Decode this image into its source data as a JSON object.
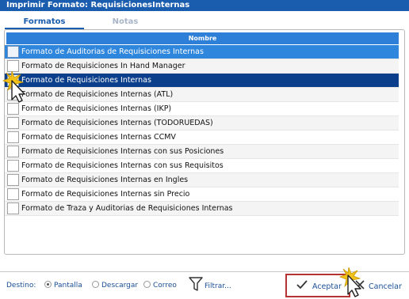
{
  "window": {
    "title": "Imprimir Formato: RequisicionesInternas"
  },
  "tabs": [
    {
      "label": "Formatos",
      "active": true
    },
    {
      "label": "Notas",
      "active": false
    }
  ],
  "grid": {
    "column_header": "Nombre",
    "rows": [
      {
        "label": "Formato de Auditorias de Requisiciones Internas",
        "state": "hover"
      },
      {
        "label": "Formato de Requisiciones In Hand Manager",
        "state": "normal"
      },
      {
        "label": "Formato de Requisiciones Internas",
        "state": "selected"
      },
      {
        "label": "Formato de Requisiciones Internas (ATL)",
        "state": "normal"
      },
      {
        "label": "Formato de Requisiciones Internas (IKP)",
        "state": "normal"
      },
      {
        "label": "Formato de Requisiciones Internas (TODORUEDAS)",
        "state": "normal"
      },
      {
        "label": "Formato de Requisiciones Internas CCMV",
        "state": "normal"
      },
      {
        "label": "Formato de Requisiciones Internas con sus Posiciones",
        "state": "normal"
      },
      {
        "label": "Formato de Requisiciones Internas con sus Requisitos",
        "state": "normal"
      },
      {
        "label": "Formato de Requisiciones Internas en Ingles",
        "state": "normal"
      },
      {
        "label": "Formato de Requisiciones Internas sin Precio",
        "state": "normal"
      },
      {
        "label": "Formato de Traza y Auditorias de Requisiciones Internas",
        "state": "normal"
      }
    ]
  },
  "footer": {
    "destino_label": "Destino:",
    "options": [
      {
        "label": "Pantalla",
        "selected": true
      },
      {
        "label": "Descargar",
        "selected": false
      },
      {
        "label": "Correo",
        "selected": false
      }
    ],
    "filter_label": "Filtrar...",
    "accept_label": "Aceptar",
    "cancel_label": "Cancelar"
  },
  "colors": {
    "titlebar": "#1a5cae",
    "header": "#2e7fd8",
    "selected_row": "#0b3f8c",
    "hover_row": "#2f86dd",
    "accept_outline": "#b53333",
    "link_text": "#1a4f96"
  }
}
